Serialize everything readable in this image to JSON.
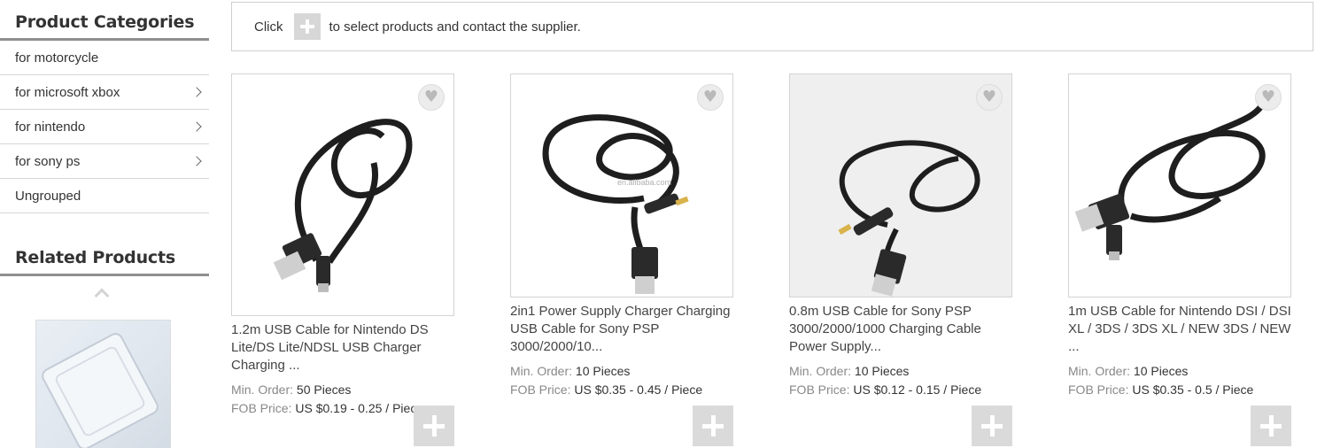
{
  "sidebar": {
    "categories_heading": "Product Categories",
    "categories": [
      {
        "label": "for motorcycle",
        "has_children": false
      },
      {
        "label": "for microsoft xbox",
        "has_children": true
      },
      {
        "label": "for nintendo",
        "has_children": true
      },
      {
        "label": "for sony ps",
        "has_children": true
      },
      {
        "label": "Ungrouped",
        "has_children": false
      }
    ],
    "related_heading": "Related Products"
  },
  "notice": {
    "prefix": "Click",
    "suffix": "to select products and contact the supplier."
  },
  "labels": {
    "min_order": "Min. Order:",
    "fob_price": "FOB Price:"
  },
  "products": [
    {
      "title": "1.2m USB Cable for Nintendo DS Lite/DS Lite/NDSL USB Charger Charging ...",
      "min_order": "50 Pieces",
      "fob_price": "US $0.19 - 0.25 / Piece"
    },
    {
      "title": "2in1 Power Supply Charger Charging USB Cable for Sony PSP 3000/2000/10...",
      "min_order": "10 Pieces",
      "fob_price": "US $0.35 - 0.45 / Piece",
      "watermark": "en.alibaba.com"
    },
    {
      "title": "0.8m USB Cable for Sony PSP 3000/2000/1000 Charging Cable Power Supply...",
      "min_order": "10 Pieces",
      "fob_price": "US $0.12 - 0.15 / Piece"
    },
    {
      "title": "1m USB Cable for Nintendo DSI / DSI XL / 3DS / 3DS XL / NEW 3DS / NEW ...",
      "min_order": "10 Pieces",
      "fob_price": "US $0.35 - 0.5 / Piece"
    }
  ],
  "colors": {
    "heading_underline": "#8f8f8f",
    "add_button": "#dadada",
    "label_grey": "#888888"
  }
}
